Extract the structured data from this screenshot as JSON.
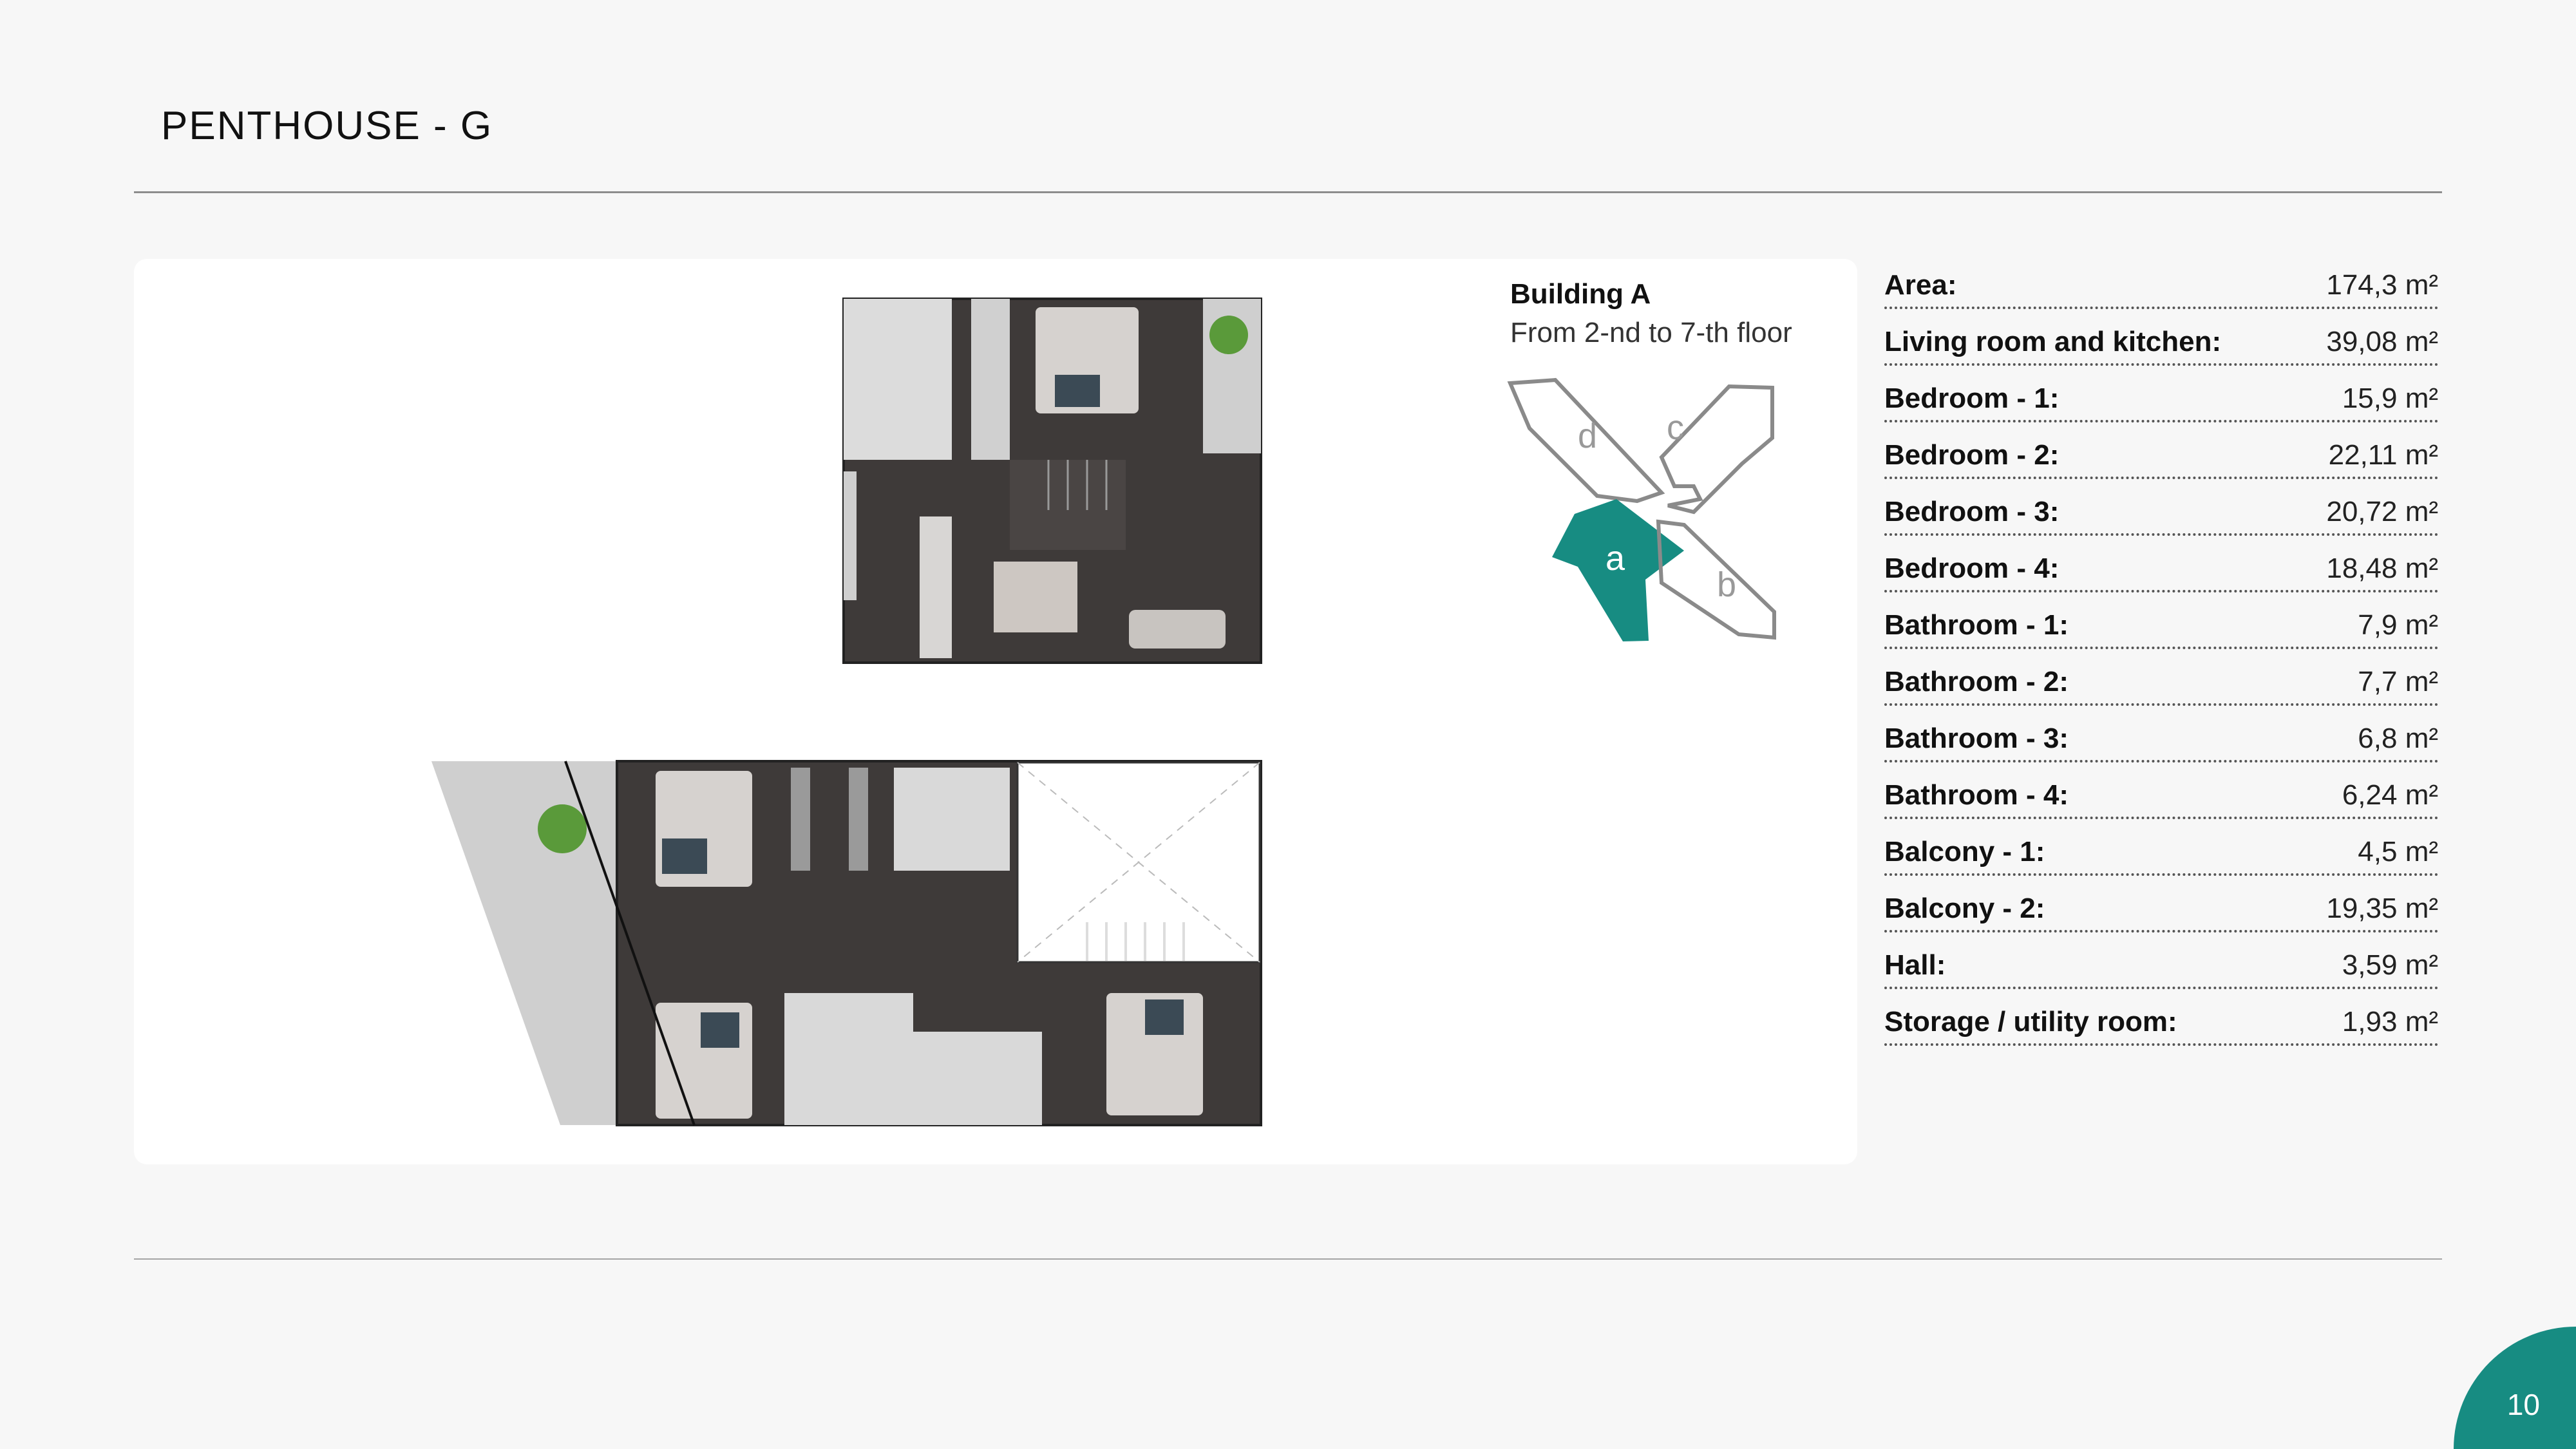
{
  "header": {
    "title": "PENTHOUSE - G"
  },
  "building": {
    "title": "Building A",
    "floors": "From 2-nd to 7-th floor",
    "sections": [
      "d",
      "c",
      "a",
      "b"
    ],
    "highlighted_section": "a",
    "accent_color": "#178c82"
  },
  "specs": [
    {
      "label": "Area:",
      "value": "174,3 m²"
    },
    {
      "label": "Living room and kitchen:",
      "value": "39,08 m²"
    },
    {
      "label": "Bedroom - 1:",
      "value": "15,9 m²"
    },
    {
      "label": "Bedroom - 2:",
      "value": "22,11 m²"
    },
    {
      "label": "Bedroom - 3:",
      "value": "20,72 m²"
    },
    {
      "label": "Bedroom - 4:",
      "value": "18,48 m²"
    },
    {
      "label": "Bathroom - 1:",
      "value": "7,9 m²"
    },
    {
      "label": "Bathroom - 2:",
      "value": "7,7 m²"
    },
    {
      "label": "Bathroom - 3:",
      "value": "6,8 m²"
    },
    {
      "label": "Bathroom - 4:",
      "value": "6,24 m²"
    },
    {
      "label": "Balcony - 1:",
      "value": "4,5 m²"
    },
    {
      "label": "Balcony - 2:",
      "value": "19,35 m²"
    },
    {
      "label": "Hall:",
      "value": "3,59 m²"
    },
    {
      "label": "Storage / utility room:",
      "value": "1,93 m²"
    }
  ],
  "page": {
    "number": "10"
  }
}
